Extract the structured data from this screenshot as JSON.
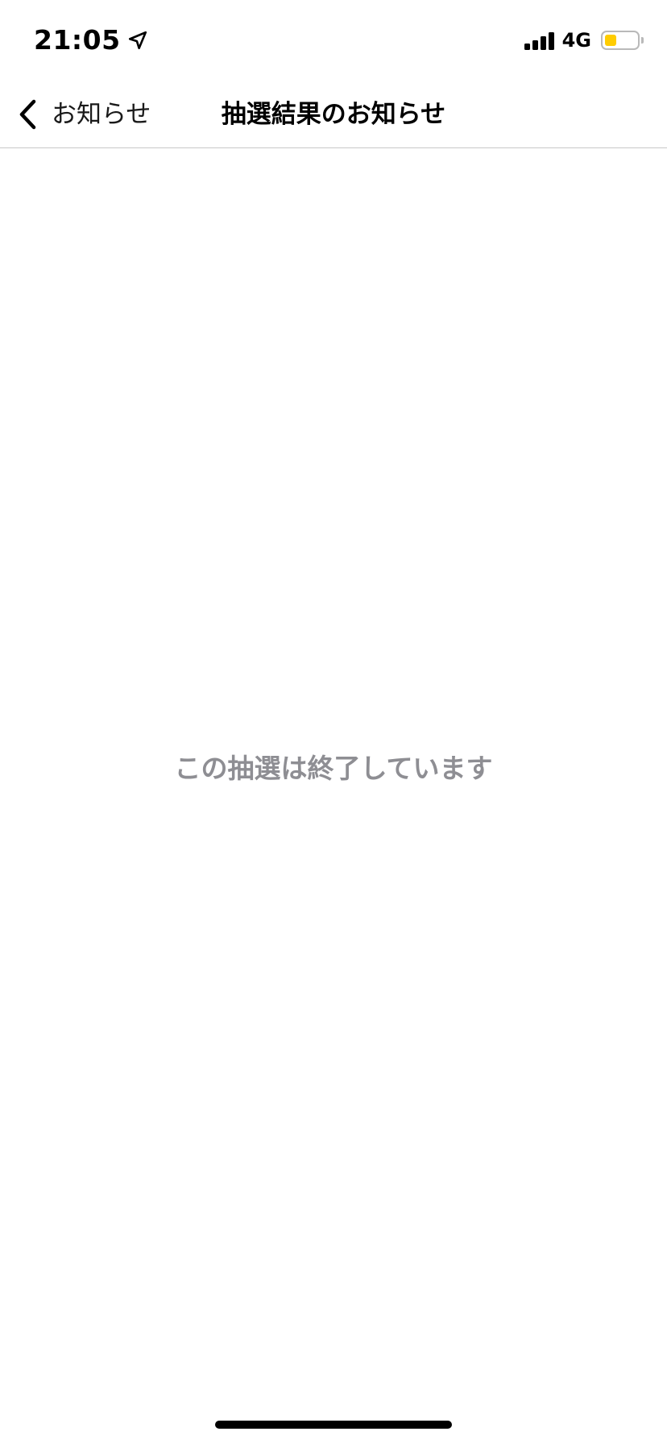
{
  "status_bar": {
    "time": "21:05",
    "network": "4G",
    "location_icon": "location-arrow-icon",
    "signal_icon": "cellular-signal-icon",
    "battery_icon": "battery-low-icon",
    "battery_color": "#ffcc00",
    "battery_level": 0.25
  },
  "nav": {
    "back_label": "お知らせ",
    "back_icon": "chevron-left-icon",
    "title": "抽選結果のお知らせ"
  },
  "main": {
    "message": "この抽選は終了しています",
    "message_color": "#8e8e93"
  }
}
